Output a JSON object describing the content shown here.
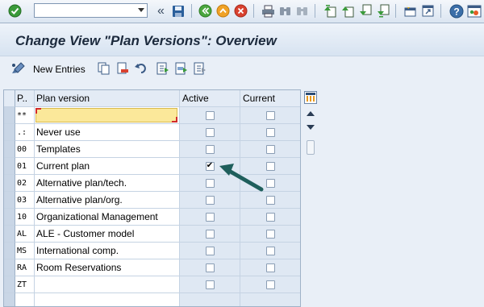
{
  "command_field": {
    "value": ""
  },
  "title": "Change View \"Plan Versions\": Overview",
  "app_toolbar": {
    "new_entries_label": "New Entries"
  },
  "table": {
    "columns": [
      "P..",
      "Plan version",
      "Active",
      "Current"
    ],
    "rows": [
      {
        "p": "**",
        "plan_version": "",
        "active": false,
        "current": false
      },
      {
        "p": ".:",
        "plan_version": "Never use",
        "active": false,
        "current": false
      },
      {
        "p": "00",
        "plan_version": "Templates",
        "active": false,
        "current": false
      },
      {
        "p": "01",
        "plan_version": "Current plan",
        "active": true,
        "current": false
      },
      {
        "p": "02",
        "plan_version": "Alternative plan/tech.",
        "active": false,
        "current": false
      },
      {
        "p": "03",
        "plan_version": "Alternative plan/org.",
        "active": false,
        "current": false
      },
      {
        "p": "10",
        "plan_version": "Organizational Management",
        "active": false,
        "current": false
      },
      {
        "p": "AL",
        "plan_version": "ALE - Customer model",
        "active": false,
        "current": false
      },
      {
        "p": "MS",
        "plan_version": "International comp.",
        "active": false,
        "current": false
      },
      {
        "p": "RA",
        "plan_version": "Room Reservations",
        "active": false,
        "current": false
      },
      {
        "p": "ZT",
        "plan_version": "",
        "active": false,
        "current": false
      },
      {
        "p": "",
        "plan_version": "",
        "active": false,
        "current": false
      }
    ]
  },
  "icons": {
    "toolbar": [
      "enter-icon",
      "back-icon",
      "save-icon",
      "green-back-icon",
      "exit-icon",
      "cancel-icon",
      "print-icon",
      "find-icon",
      "find-next-icon",
      "first-page-icon",
      "previous-page-icon",
      "next-page-icon",
      "last-page-icon",
      "new-session-icon",
      "shortcut-icon",
      "help-icon",
      "customize-layout-icon"
    ],
    "app_toolbar": [
      "display-change-icon",
      "copy-as-icon",
      "delete-icon",
      "undo-change-icon",
      "select-all-icon",
      "select-block-icon",
      "deselect-all-icon"
    ]
  },
  "colors": {
    "annotation_arrow": "#1f5f5c",
    "active_column_bg": "#dfe8f3",
    "title_text": "#1c2a3d"
  }
}
